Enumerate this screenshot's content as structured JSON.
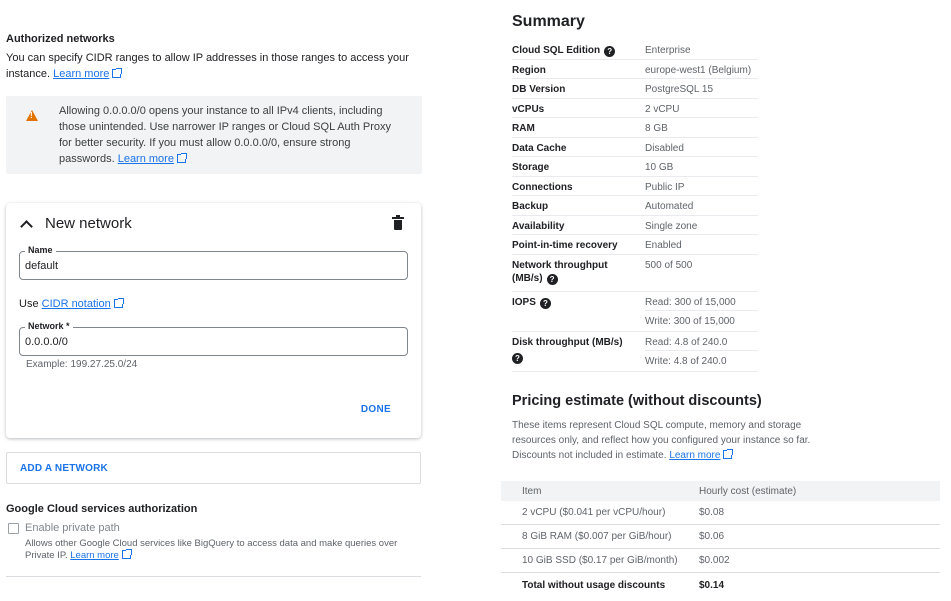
{
  "authorized": {
    "title": "Authorized networks",
    "desc": "You can specify CIDR ranges to allow IP addresses in those ranges to access your instance.",
    "learn_more": "Learn more",
    "warning": "Allowing 0.0.0.0/0 opens your instance to all IPv4 clients, including those unintended. Use narrower IP ranges or Cloud SQL Auth Proxy for better security. If you must allow 0.0.0.0/0, ensure strong passwords.",
    "warning_link": "Learn more"
  },
  "network_card": {
    "title": "New network",
    "name_label": "Name",
    "name_value": "default",
    "use_label": "Use",
    "cidr_link": "CIDR notation",
    "network_label": "Network *",
    "network_value": "0.0.0.0/0",
    "example": "Example: 199.27.25.0/24",
    "done": "DONE"
  },
  "add_network": "ADD A NETWORK",
  "gcs": {
    "title": "Google Cloud services authorization",
    "checkbox_label": "Enable private path",
    "help": "Allows other Google Cloud services like BigQuery to access data and make queries over Private IP.",
    "learn_more": "Learn more"
  },
  "summary": {
    "title": "Summary",
    "rows": [
      {
        "k": "Cloud SQL Edition",
        "v": "Enterprise"
      },
      {
        "k": "Region",
        "v": "europe-west1 (Belgium)"
      },
      {
        "k": "DB Version",
        "v": "PostgreSQL 15"
      },
      {
        "k": "vCPUs",
        "v": "2 vCPU"
      },
      {
        "k": "RAM",
        "v": "8 GB"
      },
      {
        "k": "Data Cache",
        "v": "Disabled"
      },
      {
        "k": "Storage",
        "v": "10 GB"
      },
      {
        "k": "Connections",
        "v": "Public IP"
      },
      {
        "k": "Backup",
        "v": "Automated"
      },
      {
        "k": "Availability",
        "v": "Single zone"
      },
      {
        "k": "Point-in-time recovery",
        "v": "Enabled"
      },
      {
        "k": "Network throughput (MB/s)",
        "v": "500 of 500"
      },
      {
        "k": "IOPS",
        "v1": "Read: 300 of 15,000",
        "v2": "Write: 300 of 15,000"
      },
      {
        "k": "Disk throughput (MB/s)",
        "v1": "Read: 4.8 of 240.0",
        "v2": "Write: 4.8 of 240.0"
      }
    ]
  },
  "pricing": {
    "title": "Pricing estimate (without discounts)",
    "desc": "These items represent Cloud SQL compute, memory and storage resources only, and reflect how you configured your instance so far. Discounts not included in estimate.",
    "learn_more": "Learn more",
    "head_item": "Item",
    "head_cost": "Hourly cost (estimate)",
    "rows": [
      {
        "item": "2 vCPU ($0.041 per vCPU/hour)",
        "cost": "$0.08"
      },
      {
        "item": "8 GiB RAM ($0.007 per GiB/hour)",
        "cost": "$0.06"
      },
      {
        "item": "10 GiB SSD ($0.17 per GiB/month)",
        "cost": "$0.002"
      },
      {
        "item": "Total without usage discounts",
        "cost": "$0.14"
      }
    ]
  },
  "colors": {
    "link": "#1a73e8",
    "warning": "#e37400"
  }
}
